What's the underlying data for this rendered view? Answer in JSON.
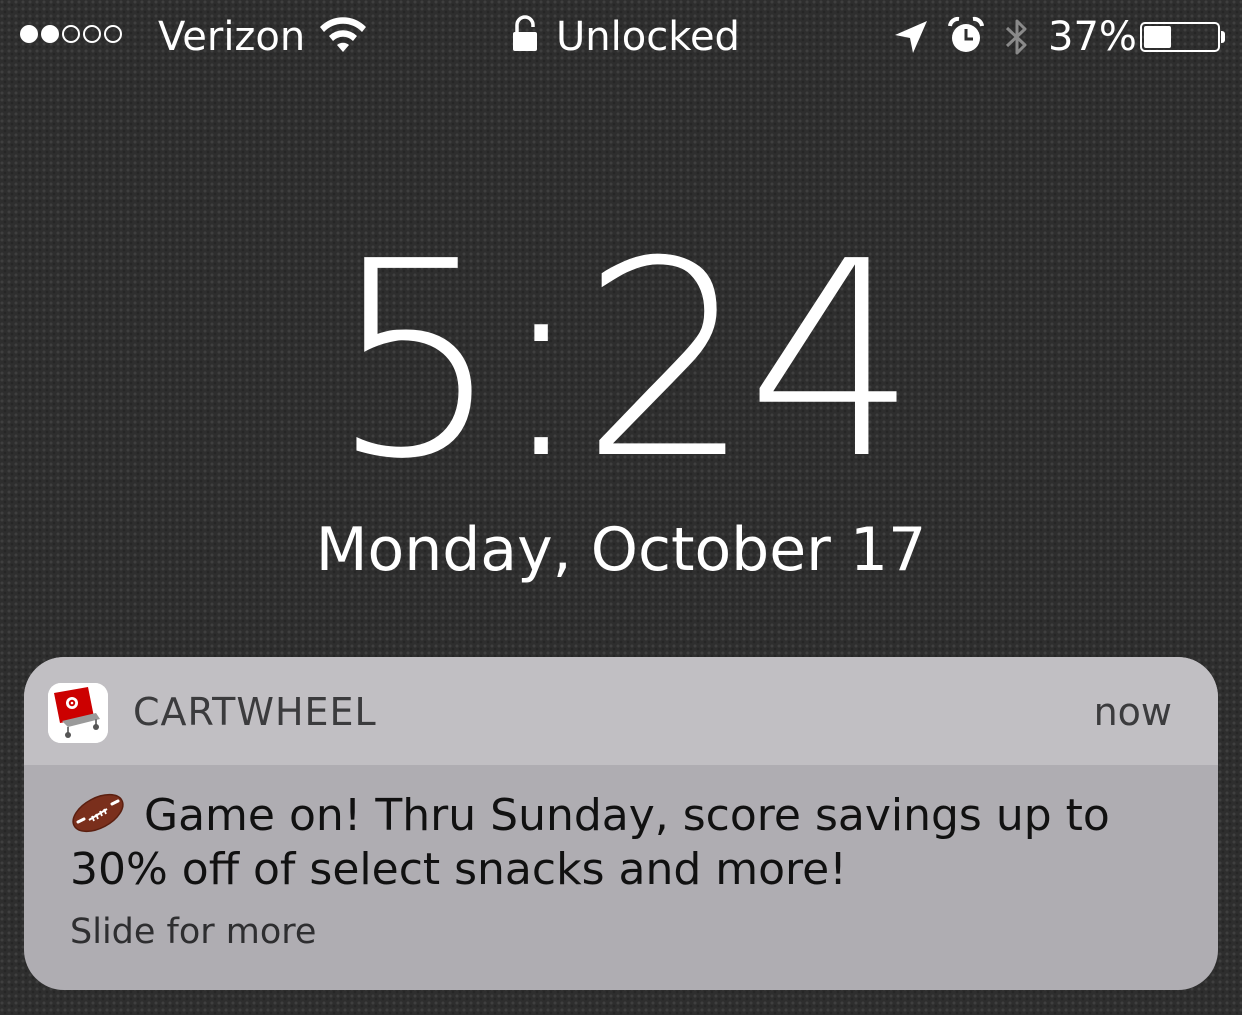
{
  "status_bar": {
    "signal_bars_filled": 2,
    "signal_bars_total": 5,
    "carrier": "Verizon",
    "lock_state": "Unlocked",
    "battery_percent": "37%",
    "battery_level": 0.37,
    "icons": [
      "wifi-icon",
      "lock-icon",
      "location-arrow-icon",
      "alarm-icon",
      "bluetooth-icon",
      "battery-icon"
    ]
  },
  "lock_screen": {
    "time": "5:24",
    "date": "Monday, October 17"
  },
  "notification": {
    "app_name": "CARTWHEEL",
    "time": "now",
    "message": "Game on! Thru Sunday, score savings up to 30% off of select snacks and more!",
    "action_hint": "Slide for more",
    "app_icon": "cartwheel-cart-icon",
    "emoji_icon": "football-icon"
  },
  "colors": {
    "notification_header": "#c1bfc3",
    "notification_body": "#afadb2",
    "brand_red": "#cc0000"
  }
}
